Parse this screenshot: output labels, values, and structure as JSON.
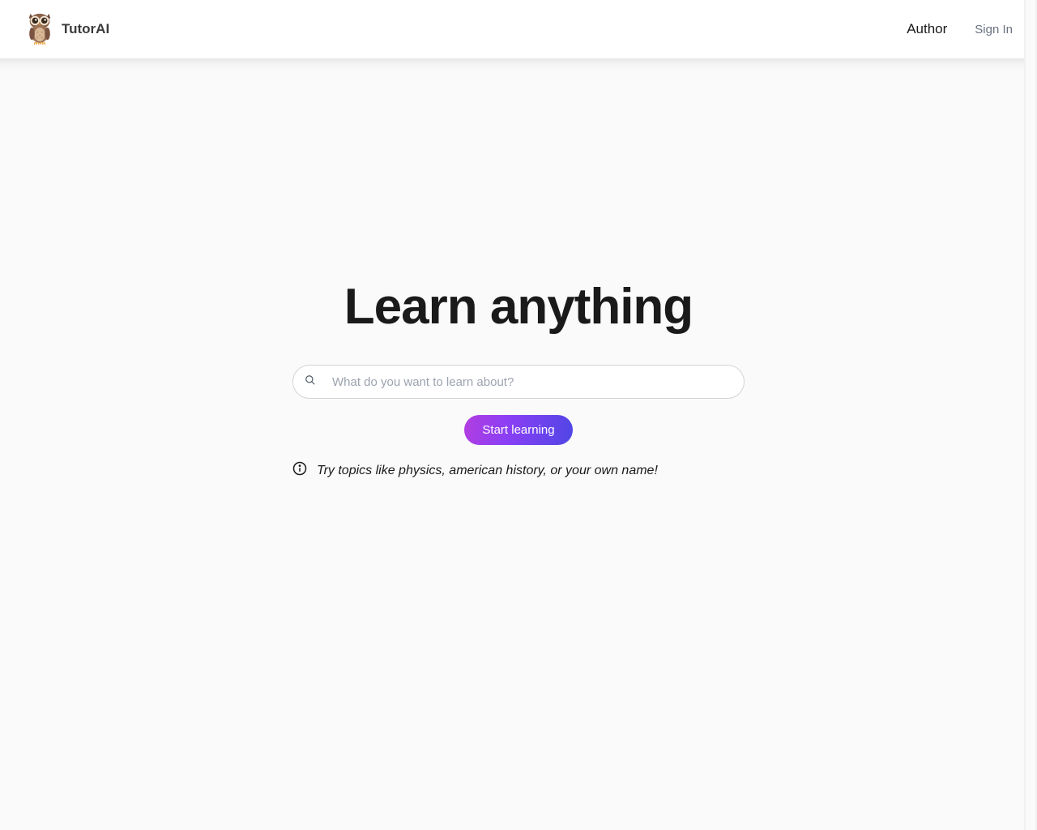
{
  "header": {
    "brand": "TutorAI",
    "nav": {
      "author": "Author",
      "signin": "Sign In"
    }
  },
  "main": {
    "hero_title": "Learn anything",
    "search_placeholder": "What do you want to learn about?",
    "start_button": "Start learning",
    "hint_text": "Try topics like physics, american history, or your own name!"
  },
  "icons": {
    "logo": "owl-icon",
    "search": "search-icon",
    "info": "info-icon"
  }
}
